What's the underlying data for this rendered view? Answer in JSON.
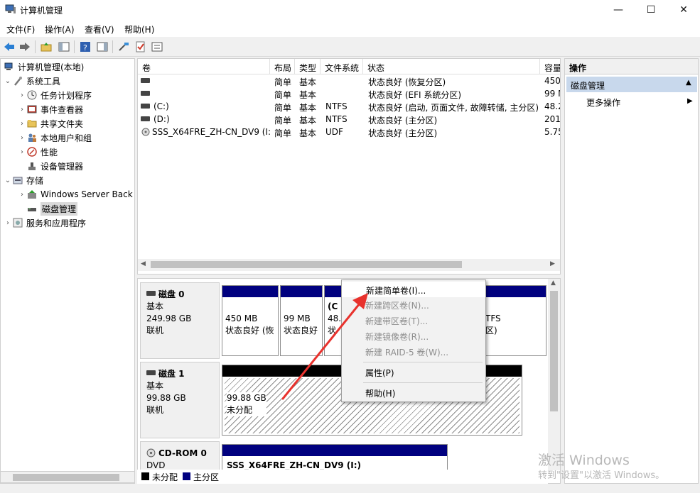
{
  "window": {
    "title": "计算机管理"
  },
  "menu": {
    "file": "文件(F)",
    "action": "操作(A)",
    "view": "查看(V)",
    "help": "帮助(H)"
  },
  "tree": {
    "root": "计算机管理(本地)",
    "system_tools": "系统工具",
    "task_scheduler": "任务计划程序",
    "event_viewer": "事件查看器",
    "shared_folders": "共享文件夹",
    "local_users": "本地用户和组",
    "performance": "性能",
    "device_manager": "设备管理器",
    "storage": "存储",
    "wsb": "Windows Server Back",
    "disk_mgmt": "磁盘管理",
    "services": "服务和应用程序"
  },
  "volumes": {
    "headers": {
      "volume": "卷",
      "layout": "布局",
      "type": "类型",
      "fs": "文件系统",
      "status": "状态",
      "capacity": "容量"
    },
    "rows": [
      {
        "name": "",
        "layout": "简单",
        "type": "基本",
        "fs": "",
        "status": "状态良好 (恢复分区)",
        "capacity": "450"
      },
      {
        "name": "",
        "layout": "简单",
        "type": "基本",
        "fs": "",
        "status": "状态良好 (EFI 系统分区)",
        "capacity": "99 M"
      },
      {
        "name": "(C:)",
        "layout": "简单",
        "type": "基本",
        "fs": "NTFS",
        "status": "状态良好 (启动, 页面文件, 故障转储, 主分区)",
        "capacity": "48.2"
      },
      {
        "name": "(D:)",
        "layout": "简单",
        "type": "基本",
        "fs": "NTFS",
        "status": "状态良好 (主分区)",
        "capacity": "201"
      },
      {
        "name": "SSS_X64FRE_ZH-CN_DV9 (I:)",
        "layout": "简单",
        "type": "基本",
        "fs": "UDF",
        "status": "状态良好 (主分区)",
        "capacity": "5.75"
      }
    ]
  },
  "disks": {
    "disk0": {
      "name": "磁盘 0",
      "kind": "基本",
      "size": "249.98 GB",
      "state": "联机",
      "p1_size": "450 MB",
      "p1_status": "状态良好 (恢",
      "p2_size": "99 MB",
      "p2_status": "状态良好",
      "p3_size": "48.",
      "p3_name": "(C",
      "p3_status": "状",
      "p4_fs": "TFS",
      "p4_status": "区)"
    },
    "disk1": {
      "name": "磁盘 1",
      "kind": "基本",
      "size": "99.88 GB",
      "state": "联机",
      "p_size": "99.88 GB",
      "p_status": "未分配"
    },
    "cdrom": {
      "name": "CD-ROM 0",
      "kind": "DVD",
      "p_label": "SSS_X64FRE_ZH-CN_DV9  (I:)"
    }
  },
  "legend": {
    "unallocated": "未分配",
    "primary": "主分区"
  },
  "actions": {
    "header": "操作",
    "section": "磁盘管理",
    "more": "更多操作"
  },
  "context_menu": {
    "new_simple": "新建简单卷(I)...",
    "new_spanned": "新建跨区卷(N)...",
    "new_striped": "新建带区卷(T)...",
    "new_mirrored": "新建镜像卷(R)...",
    "new_raid5": "新建 RAID-5 卷(W)...",
    "properties": "属性(P)",
    "help": "帮助(H)"
  },
  "watermark": {
    "line1": "激活 Windows",
    "line2": "转到\"设置\"以激活 Windows。"
  },
  "colors": {
    "primary_partition": "#00007f",
    "unallocated": "#000000",
    "annotation_arrow": "#e8322d",
    "selection": "#c8d8ec"
  },
  "icons": {
    "app": "computer-management-icon",
    "back": "back-arrow-icon",
    "forward": "forward-arrow-icon",
    "tools": "tools-icon",
    "clock": "clock-icon",
    "event": "event-viewer-icon",
    "share": "shared-folder-icon",
    "users": "users-icon",
    "perf": "performance-icon",
    "device": "device-manager-icon",
    "storage": "storage-icon",
    "backup": "backup-icon",
    "disk": "disk-icon",
    "services": "services-icon"
  }
}
